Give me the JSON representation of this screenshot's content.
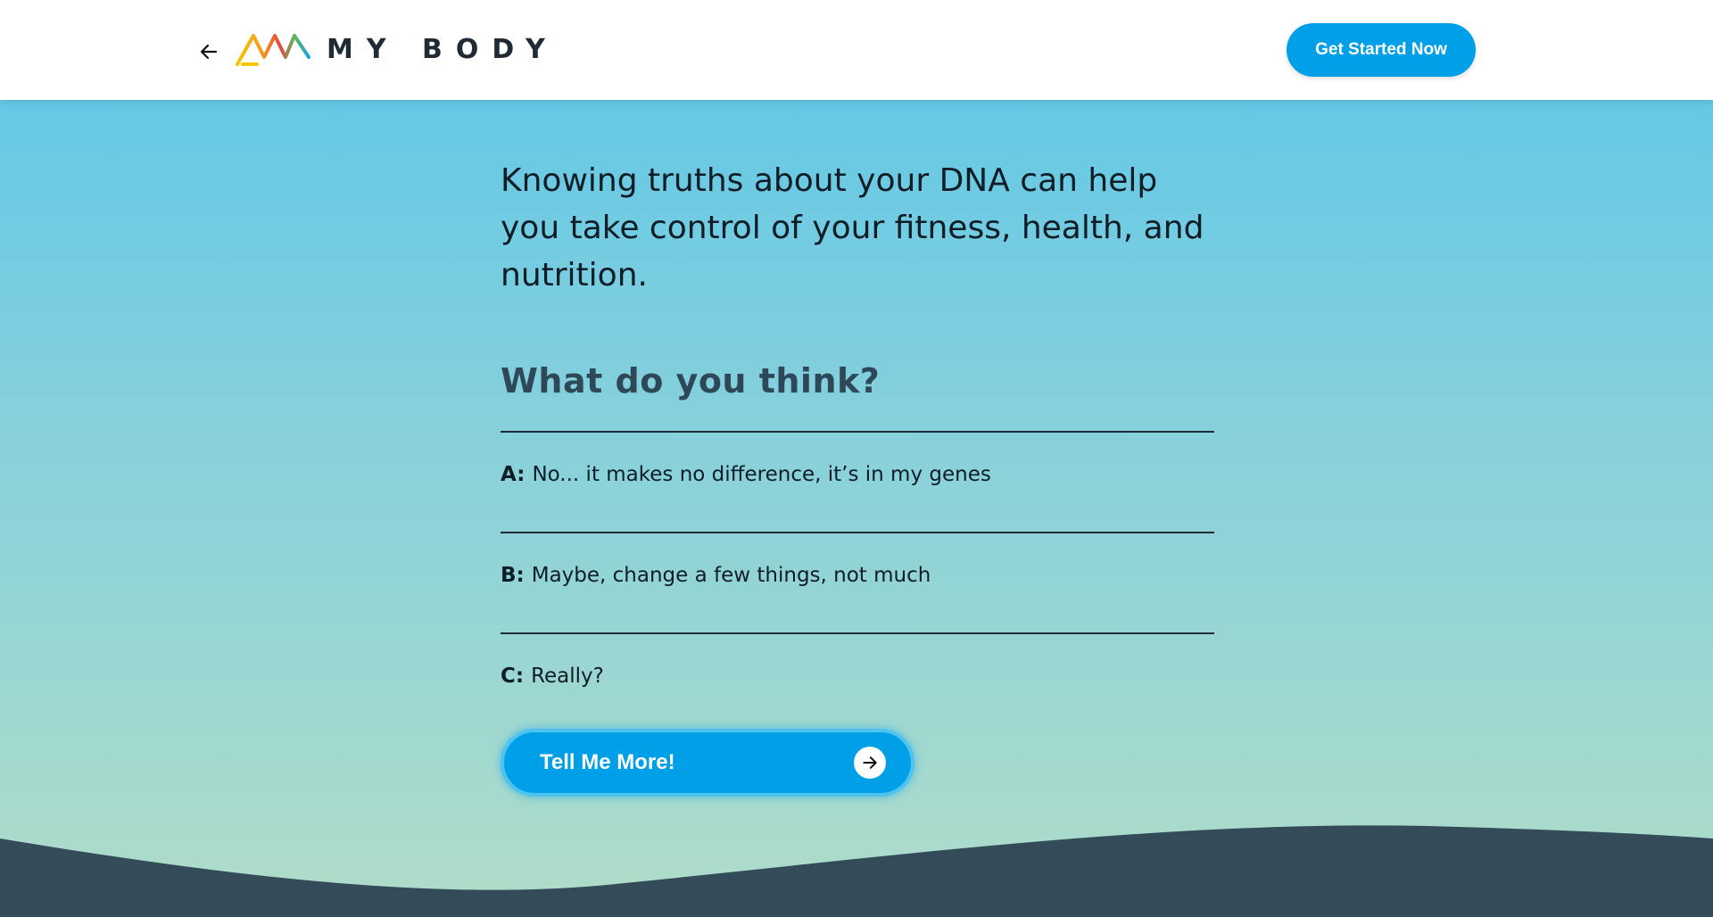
{
  "header": {
    "back_icon": "arrow-left-icon",
    "logo_text": "MY BODY",
    "cta_label": "Get Started Now",
    "cta_color": "#00a0e9"
  },
  "main": {
    "intro": "Knowing truths about your DNA can help you take control of your fitness, health, and nutrition.",
    "question": "What do you think?",
    "options": [
      {
        "letter": "A:",
        "text": "No... it makes no difference, it’s in my genes"
      },
      {
        "letter": "B:",
        "text": "Maybe, change a few things, not much"
      },
      {
        "letter": "C:",
        "text": "Really?"
      }
    ],
    "cta_label": "Tell Me More!",
    "cta_icon": "arrow-right-circle-icon"
  },
  "colors": {
    "gradient_top": "#5bc6e8",
    "gradient_bottom": "#b0ddc9",
    "wave": "#344b5a",
    "text_dark": "#0f1d26",
    "question_color": "#2f4858"
  }
}
